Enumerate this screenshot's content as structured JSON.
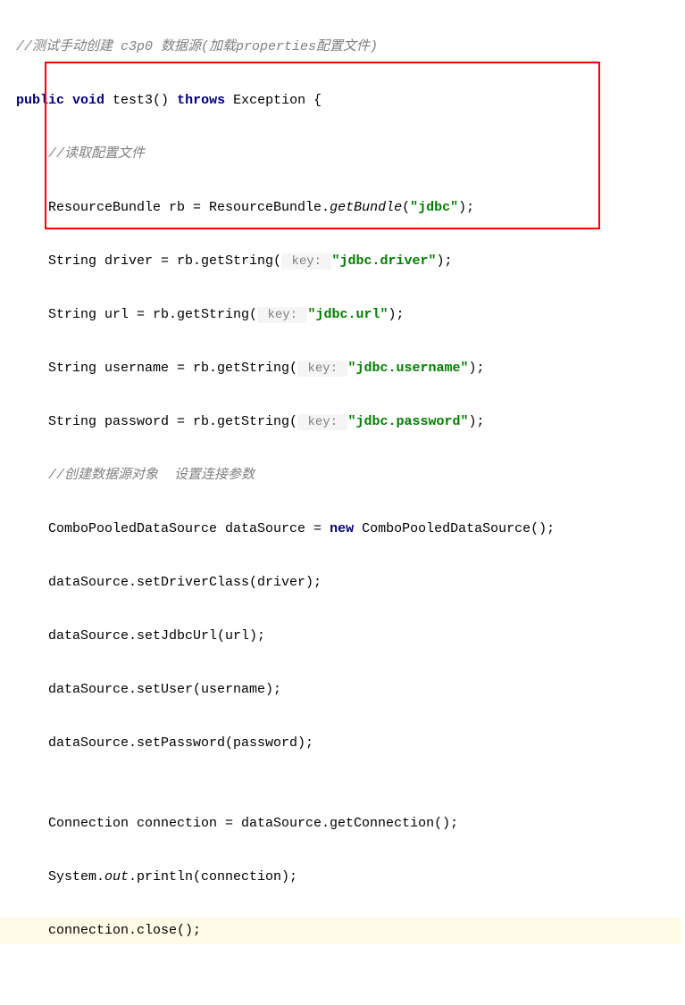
{
  "code": {
    "line1_comment": "//测试手动创建 c3p0 数据源(加载properties配置文件)",
    "line2_kw_public": "public",
    "line2_kw_void": "void",
    "line2_method": " test3() ",
    "line2_kw_throws": "throws",
    "line2_exception": " Exception {",
    "line3_comment": "//读取配置文件",
    "line4_part1": "ResourceBundle rb = ResourceBundle.",
    "line4_method": "getBundle",
    "line4_paren_open": "(",
    "line4_str": "\"jdbc\"",
    "line4_paren_close": ");",
    "line5_part1": "String driver = rb.getString(",
    "line5_hint": " key: ",
    "line5_str": "\"jdbc.driver\"",
    "line5_end": ");",
    "line6_part1": "String url = rb.getString(",
    "line6_hint": " key: ",
    "line6_str": "\"jdbc.url\"",
    "line6_end": ");",
    "line7_part1": "String username = rb.getString(",
    "line7_hint": " key: ",
    "line7_str": "\"jdbc.username\"",
    "line7_end": ");",
    "line8_part1": "String password = rb.getString(",
    "line8_hint": " key: ",
    "line8_str": "\"jdbc.password\"",
    "line8_end": ");",
    "line9_comment": "//创建数据源对象  设置连接参数",
    "line10_part1": "ComboPooledDataSource dataSource = ",
    "line10_kw_new": "new",
    "line10_part2": " ComboPooledDataSource();",
    "line11": "dataSource.setDriverClass(driver);",
    "line12": "dataSource.setJdbcUrl(url);",
    "line13": "dataSource.setUser(username);",
    "line14": "dataSource.setPassword(password);",
    "line15_blank": "",
    "line16": "Connection connection = dataSource.getConnection();",
    "line17_part1": "System.",
    "line17_out": "out",
    "line17_part2": ".println(connection);",
    "line18": "connection.close();"
  }
}
